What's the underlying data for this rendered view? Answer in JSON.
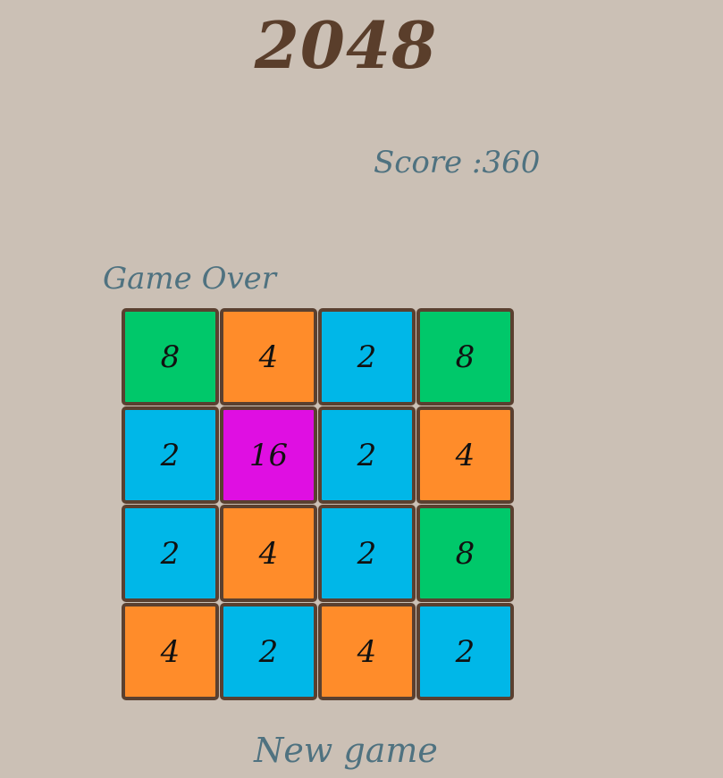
{
  "game": {
    "title": "2048",
    "score_text": "Score :360",
    "status_text": "Game Over",
    "new_game_label": "New game"
  },
  "tile_colors": {
    "2": "#00b7e8",
    "4": "#ff8c2a",
    "8": "#00c86a",
    "16": "#df0fe2"
  },
  "board": [
    [
      "8",
      "4",
      "2",
      "8"
    ],
    [
      "2",
      "16",
      "2",
      "4"
    ],
    [
      "2",
      "4",
      "2",
      "8"
    ],
    [
      "4",
      "2",
      "4",
      "2"
    ]
  ]
}
